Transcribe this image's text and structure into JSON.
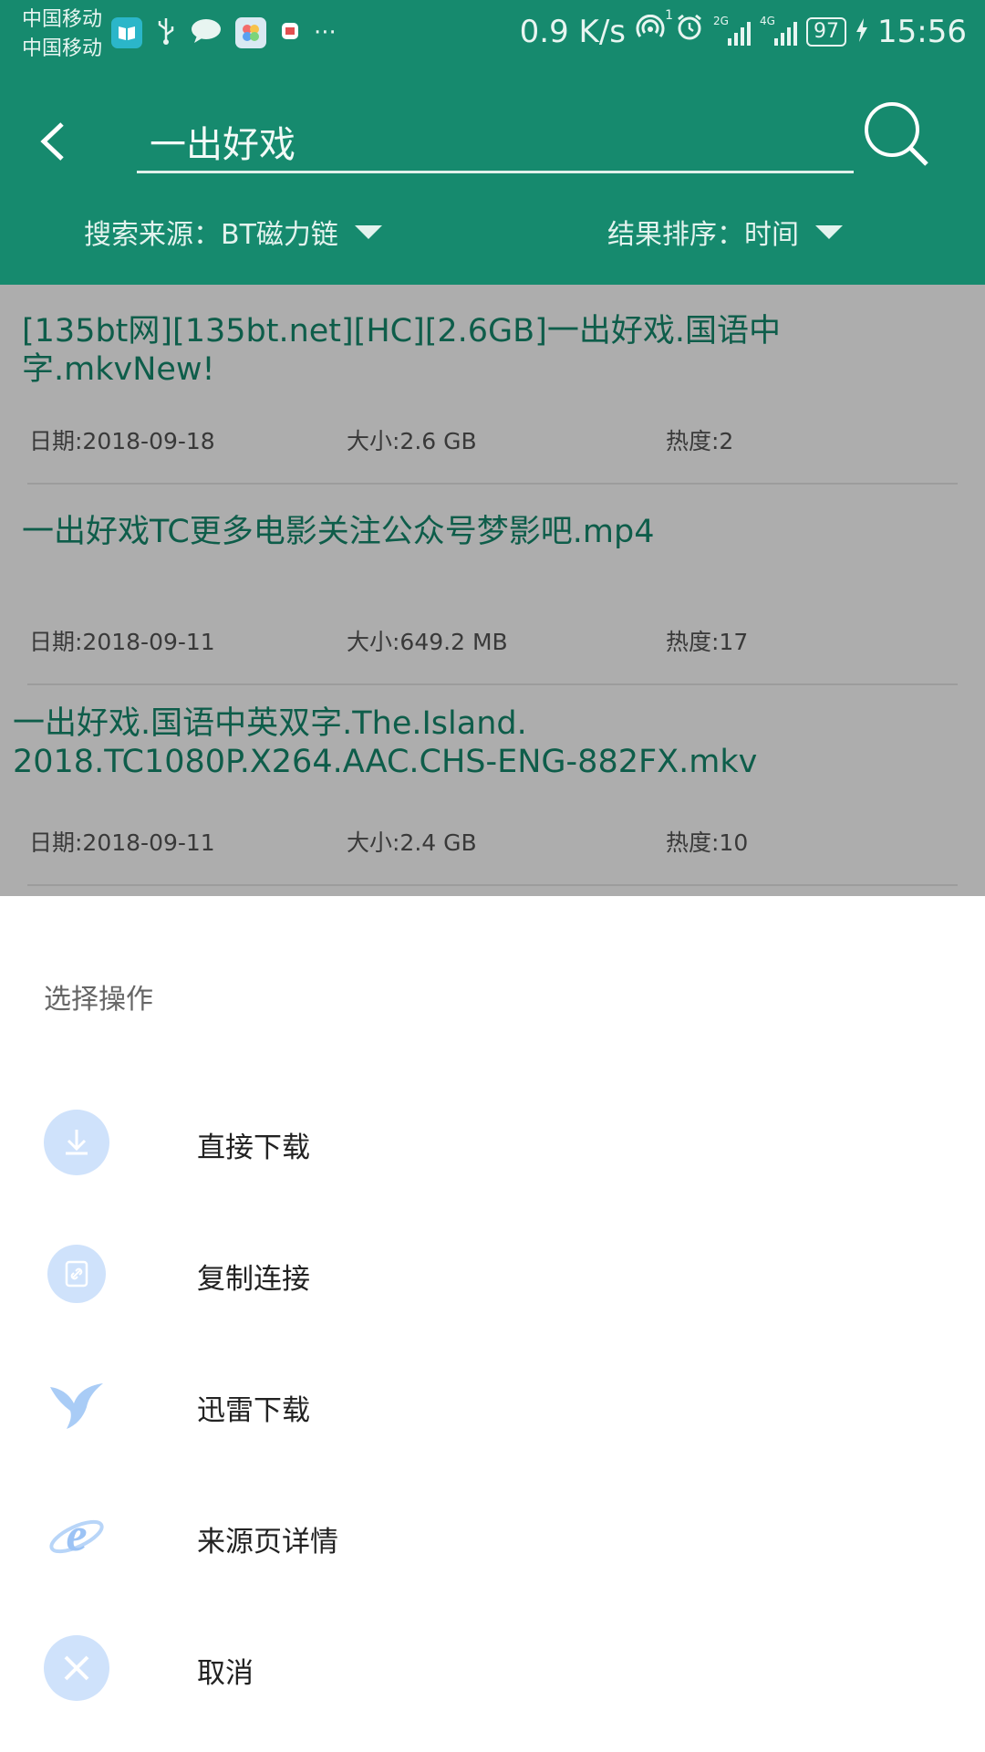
{
  "status_bar": {
    "carrier_1": "中国移动",
    "carrier_2": "中国移动",
    "net_speed": "0.9 K/s",
    "hotspot_sup": "1",
    "sig1_label": "2G",
    "sig2_label": "4G",
    "battery": "97",
    "time": "15:56",
    "more": "···"
  },
  "search": {
    "query": "一出好戏",
    "source_label": "搜索来源：BT磁力链",
    "sort_label": "结果排序：时间"
  },
  "results": [
    {
      "title": "[135bt网][135bt.net][HC][2.6GB]一出好戏.国语中字.mkvNew!",
      "date": "日期:2018-09-18",
      "size": "大小:2.6 GB",
      "heat": "热度:2"
    },
    {
      "title": "一出好戏TC更多电影关注公众号梦影吧.mp4",
      "date": "日期:2018-09-11",
      "size": "大小:649.2 MB",
      "heat": "热度:17"
    },
    {
      "title": "一出好戏.国语中英双字.The.Island.\n2018.TC1080P.X264.AAC.CHS-ENG-882FX.mkv",
      "date": "日期:2018-09-11",
      "size": "大小:2.4 GB",
      "heat": "热度:10"
    }
  ],
  "action_sheet": {
    "title": "选择操作",
    "actions": [
      {
        "label": "直接下载",
        "icon": "download-icon"
      },
      {
        "label": "复制连接",
        "icon": "copy-link-icon"
      },
      {
        "label": "迅雷下载",
        "icon": "thunder-bird-icon"
      },
      {
        "label": "来源页详情",
        "icon": "browser-e-icon"
      },
      {
        "label": "取消",
        "icon": "close-icon"
      }
    ]
  },
  "colors": {
    "header_bg": "#168a6e",
    "title_green": "#168a6e",
    "icon_light_blue": "#cfe2fb",
    "icon_blue": "#9cc3f5"
  }
}
